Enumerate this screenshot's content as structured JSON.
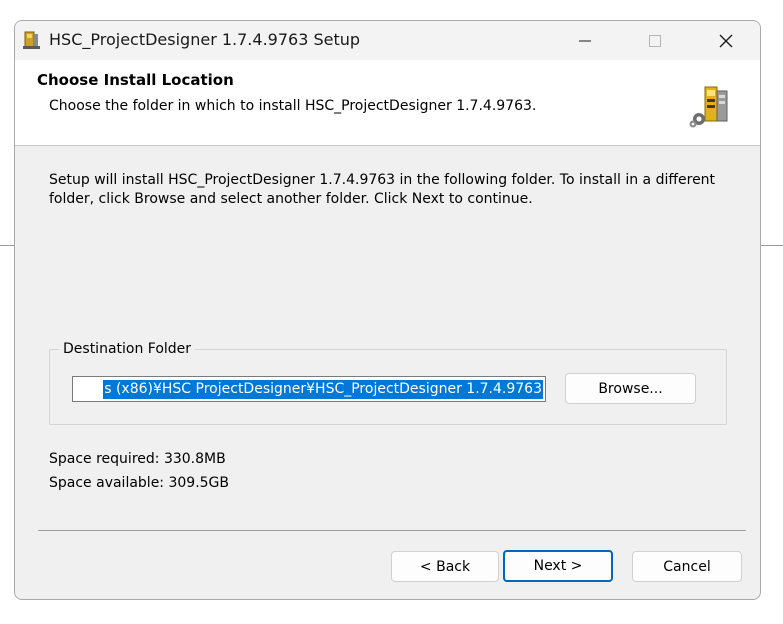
{
  "window": {
    "title": "HSC_ProjectDesigner 1.7.4.9763 Setup",
    "controls": {
      "minimize": "—",
      "close": "✕"
    }
  },
  "header": {
    "title": "Choose Install Location",
    "subtitle": "Choose the folder in which to install HSC_ProjectDesigner 1.7.4.9763."
  },
  "body": {
    "intro": "Setup will install HSC_ProjectDesigner 1.7.4.9763 in the following folder. To install in a different folder, click Browse and select another folder. Click Next to continue."
  },
  "destination": {
    "label": "Destination Folder",
    "path_visible": "s (x86)¥HSC ProjectDesigner¥HSC_ProjectDesigner 1.7.4.9763",
    "browse_label": "Browse..."
  },
  "space": {
    "required": "Space required: 330.8MB",
    "available": "Space available: 309.5GB"
  },
  "buttons": {
    "back": "< Back",
    "next": "Next >",
    "cancel": "Cancel"
  },
  "colors": {
    "selection": "#0078d7",
    "default_button_border": "#0067c0",
    "dialog_bg": "#f0f0f0"
  }
}
